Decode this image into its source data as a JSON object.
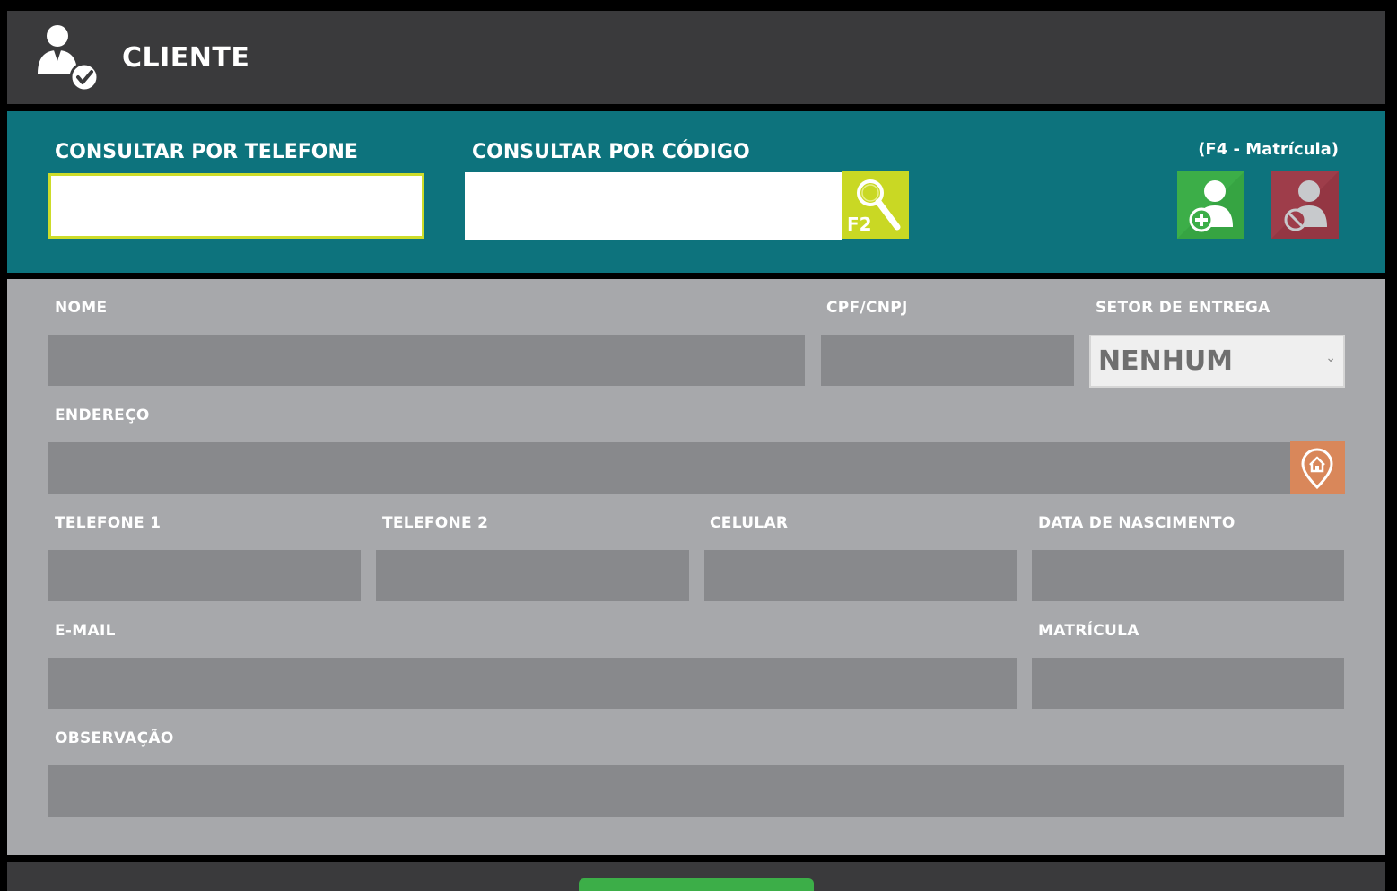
{
  "header": {
    "title": "CLIENTE",
    "icon": "user-check-icon"
  },
  "search": {
    "phone_label": "CONSULTAR POR TELEFONE",
    "phone_value": "",
    "code_label": "CONSULTAR POR CÓDIGO",
    "code_value": "",
    "search_button_label": "F2",
    "search_icon": "magnifier-icon",
    "matricula_hint": "(F4 - Matrícula)",
    "add_client_icon": "user-add-icon",
    "block_client_icon": "user-block-icon"
  },
  "form": {
    "nome_label": "NOME",
    "cpf_label": "CPF/CNPJ",
    "setor_label": "SETOR DE ENTREGA",
    "setor_value": "NENHUM",
    "endereco_label": "ENDEREÇO",
    "address_icon": "home-pin-icon",
    "telefone1_label": "TELEFONE 1",
    "telefone2_label": "TELEFONE 2",
    "celular_label": "CELULAR",
    "nascimento_label": "DATA DE NASCIMENTO",
    "email_label": "E-MAIL",
    "matricula_label": "MATRÍCULA",
    "observacao_label": "OBSERVAÇÃO"
  },
  "colors": {
    "header_bg": "#3a3a3c",
    "search_bg": "#0d737d",
    "form_bg": "#a7a8ab",
    "field_bg": "#88898c",
    "accent_lime": "#c9d824",
    "add_green": "#3cae48",
    "block_red": "#9e3d4a",
    "address_orange": "#d9875a"
  }
}
